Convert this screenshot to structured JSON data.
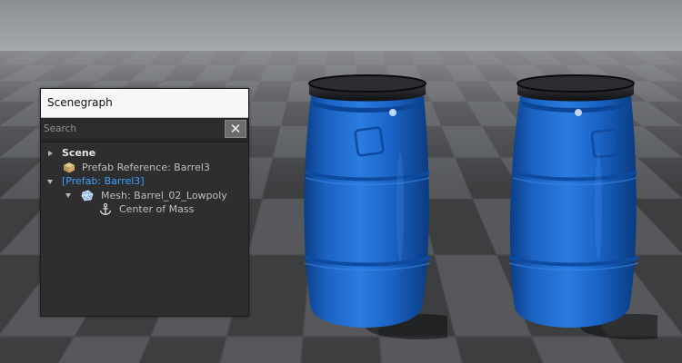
{
  "panel": {
    "title": "Scenegraph",
    "search_placeholder": "Search",
    "clear_glyph": "✕"
  },
  "tree": [
    {
      "label": "Scene",
      "icon": "none",
      "expander": "collapsed"
    },
    {
      "label": "Prefab Reference: Barrel3",
      "icon": "box-icon",
      "expander": "none"
    },
    {
      "label": "[Prefab: Barrel3]",
      "icon": "none",
      "expander": "expanded"
    },
    {
      "label": "Mesh: Barrel_02_Lowpoly",
      "icon": "mesh-icon",
      "expander": "expanded"
    },
    {
      "label": "Center of Mass",
      "icon": "anchor-icon",
      "expander": "none"
    }
  ],
  "colors": {
    "barrel_blue": "#1f6fd0",
    "selected_text": "#3aa0ff",
    "panel_bg": "#2e2e2e"
  }
}
